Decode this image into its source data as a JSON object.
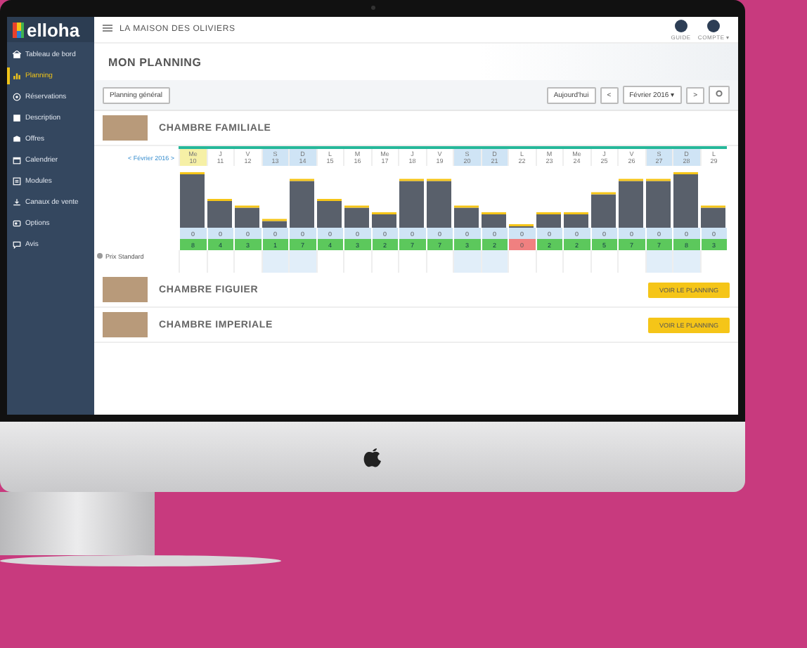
{
  "app": {
    "logo": "elloha",
    "property": "LA MAISON DES OLIVIERS",
    "top_actions": [
      {
        "label": "GUIDE"
      },
      {
        "label": "COMPTE ▾"
      }
    ],
    "sidebar": {
      "items": [
        {
          "label": "Tableau de bord",
          "selected": false
        },
        {
          "label": "Planning",
          "selected": true
        },
        {
          "label": "Réservations",
          "selected": false
        },
        {
          "label": "Description",
          "selected": false
        },
        {
          "label": "Offres",
          "selected": false
        },
        {
          "label": "Calendrier",
          "selected": false
        },
        {
          "label": "Modules",
          "selected": false
        },
        {
          "label": "Canaux de vente",
          "selected": false
        },
        {
          "label": "Options",
          "selected": false
        },
        {
          "label": "Avis",
          "selected": false
        }
      ]
    },
    "page_title": "MON PLANNING",
    "toolbar": {
      "general_button": "Planning général",
      "today_button": "Aujourd'hui",
      "prev": "<",
      "month": "Février 2016 ▾",
      "next": ">"
    },
    "rooms": [
      {
        "name": "CHAMBRE FAMILIALE",
        "month_nav": "< Février 2016 >",
        "price_label": "Prix Standard",
        "days": [
          {
            "d": "Me",
            "n": "10",
            "weekend": false,
            "today": true,
            "booked": "0",
            "available": "8"
          },
          {
            "d": "J",
            "n": "11",
            "weekend": false,
            "today": false,
            "booked": "0",
            "available": "4"
          },
          {
            "d": "V",
            "n": "12",
            "weekend": false,
            "today": false,
            "booked": "0",
            "available": "3"
          },
          {
            "d": "S",
            "n": "13",
            "weekend": true,
            "today": false,
            "booked": "0",
            "available": "1"
          },
          {
            "d": "D",
            "n": "14",
            "weekend": true,
            "today": false,
            "booked": "0",
            "available": "7"
          },
          {
            "d": "L",
            "n": "15",
            "weekend": false,
            "today": false,
            "booked": "0",
            "available": "4"
          },
          {
            "d": "M",
            "n": "16",
            "weekend": false,
            "today": false,
            "booked": "0",
            "available": "3"
          },
          {
            "d": "Me",
            "n": "17",
            "weekend": false,
            "today": false,
            "booked": "0",
            "available": "2"
          },
          {
            "d": "J",
            "n": "18",
            "weekend": false,
            "today": false,
            "booked": "0",
            "available": "7"
          },
          {
            "d": "V",
            "n": "19",
            "weekend": false,
            "today": false,
            "booked": "0",
            "available": "7"
          },
          {
            "d": "S",
            "n": "20",
            "weekend": true,
            "today": false,
            "booked": "0",
            "available": "3"
          },
          {
            "d": "D",
            "n": "21",
            "weekend": true,
            "today": false,
            "booked": "0",
            "available": "2"
          },
          {
            "d": "L",
            "n": "22",
            "weekend": false,
            "today": false,
            "booked": "0",
            "available": "0"
          },
          {
            "d": "M",
            "n": "23",
            "weekend": false,
            "today": false,
            "booked": "0",
            "available": "2"
          },
          {
            "d": "Me",
            "n": "24",
            "weekend": false,
            "today": false,
            "booked": "0",
            "available": "2"
          },
          {
            "d": "J",
            "n": "25",
            "weekend": false,
            "today": false,
            "booked": "0",
            "available": "5"
          },
          {
            "d": "V",
            "n": "26",
            "weekend": false,
            "today": false,
            "booked": "0",
            "available": "7"
          },
          {
            "d": "S",
            "n": "27",
            "weekend": true,
            "today": false,
            "booked": "0",
            "available": "7"
          },
          {
            "d": "D",
            "n": "28",
            "weekend": true,
            "today": false,
            "booked": "0",
            "available": "8"
          },
          {
            "d": "L",
            "n": "29",
            "weekend": false,
            "today": false,
            "booked": "0",
            "available": "3"
          }
        ]
      },
      {
        "name": "CHAMBRE FIGUIER",
        "button": "VOIR LE PLANNING"
      },
      {
        "name": "CHAMBRE IMPERIALE",
        "button": "VOIR LE PLANNING"
      }
    ]
  }
}
